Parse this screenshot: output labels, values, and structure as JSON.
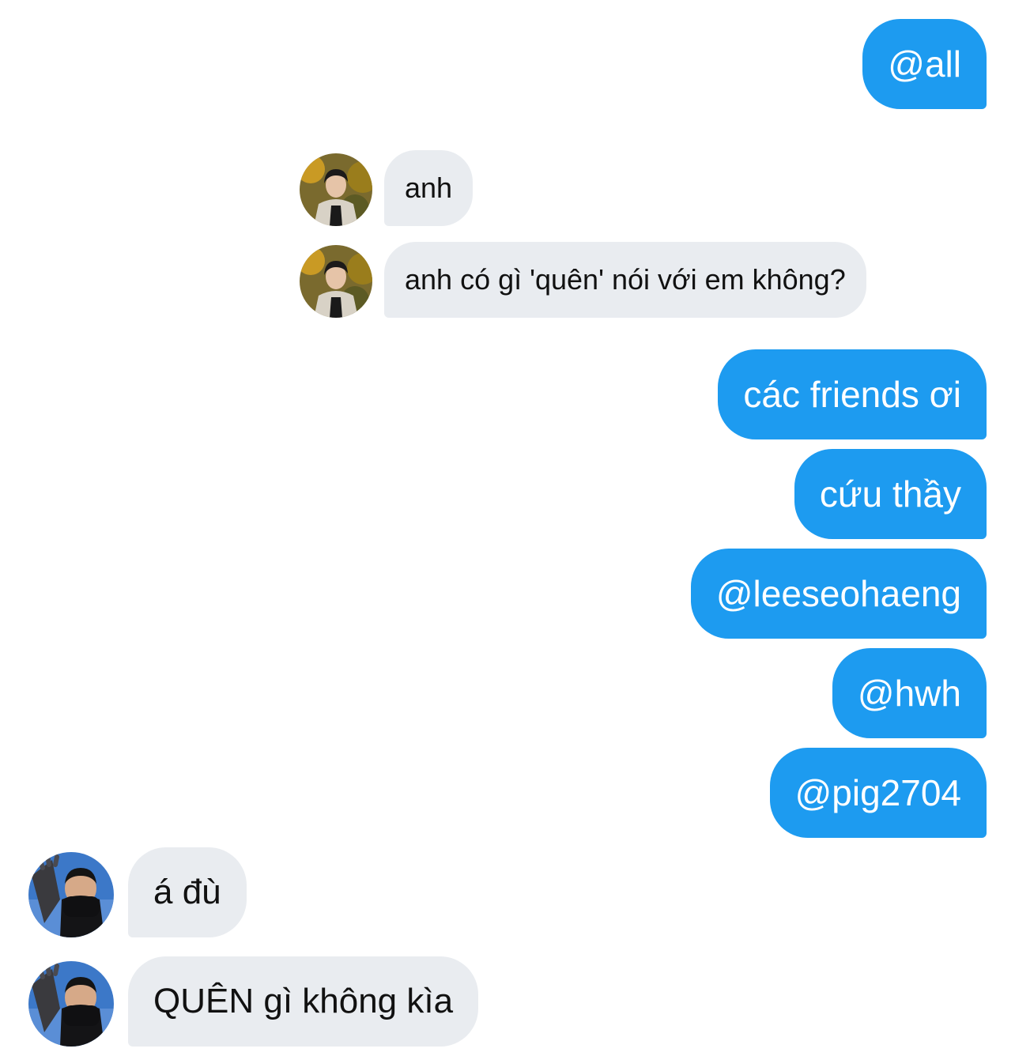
{
  "messages": [
    {
      "side": "sent",
      "text": "@all"
    },
    {
      "side": "received",
      "sender": "user-a",
      "text": "anh"
    },
    {
      "side": "received",
      "sender": "user-a",
      "text": "anh có gì 'quên' nói với em không?"
    },
    {
      "side": "sent",
      "text": "các friends ơi"
    },
    {
      "side": "sent",
      "text": "cứu thầy"
    },
    {
      "side": "sent",
      "text": "@leeseohaeng"
    },
    {
      "side": "sent",
      "text": "@hwh"
    },
    {
      "side": "sent",
      "text": "@pig2704"
    },
    {
      "side": "received",
      "sender": "user-b",
      "text": "á đù"
    },
    {
      "side": "received",
      "sender": "user-b",
      "text": "QUÊN gì không kìa"
    }
  ],
  "colors": {
    "sent_bubble": "#1d9bf0",
    "received_bubble": "#e9ecf0",
    "sent_text": "#ffffff",
    "received_text": "#111111"
  }
}
